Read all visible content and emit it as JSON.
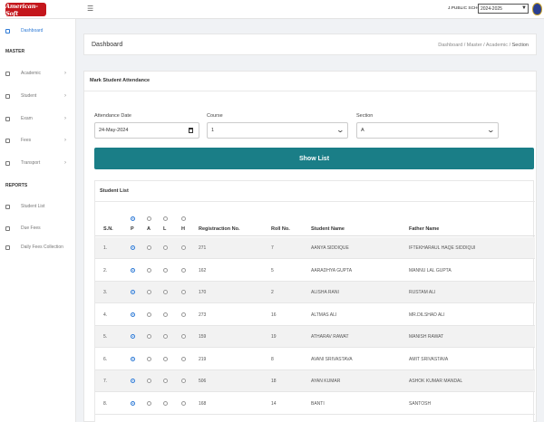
{
  "header": {
    "logo_text": "American-Soft",
    "school": "J.PUBLIC SCHOOL",
    "session": "2024-2025"
  },
  "sidebar": {
    "items": [
      {
        "label": "Dashboard",
        "icon": "desktop-icon"
      },
      {
        "label": "Academic",
        "icon": "gear-icon"
      },
      {
        "label": "Student",
        "icon": "student-icon"
      },
      {
        "label": "Exam",
        "icon": "exam-icon"
      },
      {
        "label": "Fees",
        "icon": "fees-icon"
      },
      {
        "label": "Transport",
        "icon": "bus-icon"
      },
      {
        "label": "Student List",
        "icon": "list-icon"
      },
      {
        "label": "Due Fees",
        "icon": "list-icon"
      },
      {
        "label": "Daily Fees Collection",
        "icon": "list-icon"
      }
    ],
    "section_master": "MASTER",
    "section_reports": "REPORTS"
  },
  "page": {
    "title": "Dashboard",
    "breadcrumb": [
      "Dashboard",
      "Master",
      "Academic",
      "Section"
    ]
  },
  "form": {
    "card_title": "Mark Student Attendance",
    "date_label": "Attendance Date",
    "date_value": "24-May-2024",
    "course_label": "Course",
    "course_value": "1",
    "section_label": "Section",
    "section_value": "A",
    "show_button": "Show List"
  },
  "list": {
    "title": "Student List",
    "columns": [
      "S.N.",
      "P",
      "A",
      "L",
      "H",
      "Registraction No.",
      "Roll No.",
      "Student Name",
      "Father Name"
    ],
    "rows": [
      {
        "sn": "1.",
        "reg": "271",
        "roll": "7",
        "name": "AANYA SIDDIQUE",
        "father": "IFTEKHARAUL HAQE SIDDIQUI"
      },
      {
        "sn": "2.",
        "reg": "162",
        "roll": "5",
        "name": "AARADHYA GUPTA",
        "father": "MANNU LAL GUPTA"
      },
      {
        "sn": "3.",
        "reg": "170",
        "roll": "2",
        "name": "ALISHA RANI",
        "father": "RUSTAM ALI"
      },
      {
        "sn": "4.",
        "reg": "273",
        "roll": "16",
        "name": "ALTMAS ALI",
        "father": "MR.DILSHAD ALI"
      },
      {
        "sn": "5.",
        "reg": "159",
        "roll": "19",
        "name": "ATHARAV RAWAT",
        "father": "MANISH RAWAT"
      },
      {
        "sn": "6.",
        "reg": "219",
        "roll": "8",
        "name": "AVANI SRIVASTAVA",
        "father": "AMIT SRIVASTAVA"
      },
      {
        "sn": "7.",
        "reg": "506",
        "roll": "18",
        "name": "AYAN KUMAR",
        "father": "ASHOK KUMAR MANDAL"
      },
      {
        "sn": "8.",
        "reg": "168",
        "roll": "14",
        "name": "BANTI",
        "father": "SANTOSH"
      }
    ]
  },
  "colors": {
    "accent": "#2f7bd6",
    "button": "#1a7e87",
    "logo": "#c4161c"
  }
}
